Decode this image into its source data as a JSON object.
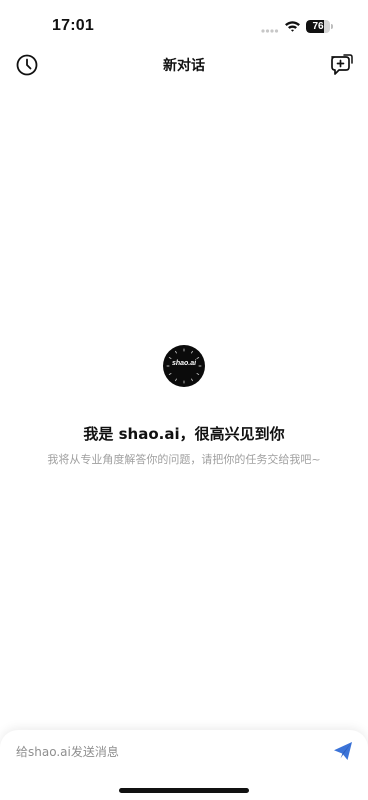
{
  "status_bar": {
    "time": "17:01",
    "battery_percent": 76,
    "battery_label": "76",
    "icons": [
      "cellular-signal-icon",
      "wifi-icon",
      "battery-icon"
    ]
  },
  "header": {
    "title": "新对话",
    "left_icon": "clock-history-icon",
    "right_icon": "new-chat-icon"
  },
  "welcome": {
    "logo_text": "shao.ai",
    "title": "我是 shao.ai，很高兴见到你",
    "subtitle": "我将从专业角度解答你的问题，请把你的任务交给我吧~"
  },
  "composer": {
    "placeholder": "给shao.ai发送消息",
    "value": "",
    "send_icon": "paper-plane-icon"
  },
  "colors": {
    "background": "#ffffff",
    "text_primary": "#111111",
    "text_secondary": "#a0a0a0",
    "accent": "#3b73d8",
    "logo_background": "#0b0b0b"
  }
}
